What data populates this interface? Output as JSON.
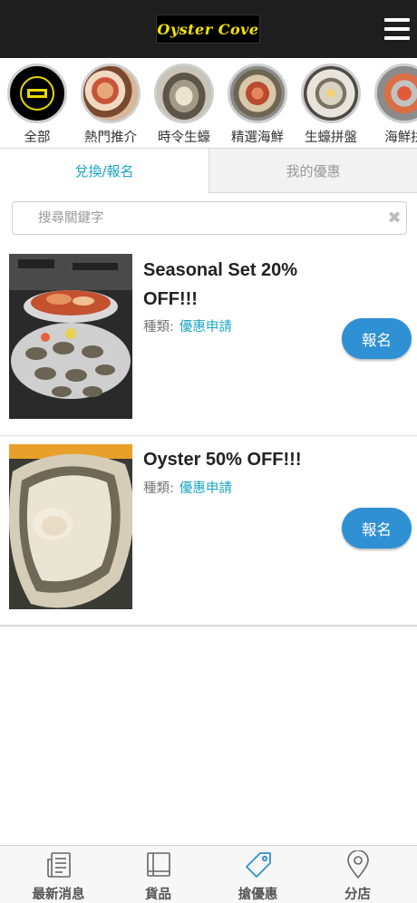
{
  "header": {
    "logo_text": "Oyster Cove",
    "menu_icon": "hamburger-menu-icon"
  },
  "categories": [
    {
      "label": "全部"
    },
    {
      "label": "熱門推介"
    },
    {
      "label": "時令生蠔"
    },
    {
      "label": "精選海鮮"
    },
    {
      "label": "生蠔拼盤"
    },
    {
      "label": "海鮮拼"
    }
  ],
  "tabs": {
    "redeem": "兌換/報名",
    "my_offers": "我的優惠"
  },
  "search": {
    "placeholder": "搜尋關鍵字",
    "value": ""
  },
  "offers": [
    {
      "title": "Seasonal Set 20% OFF!!!",
      "type_label": "種類:",
      "type_value": "優惠申請",
      "button": "報名"
    },
    {
      "title": "Oyster 50% OFF!!!",
      "type_label": "種類:",
      "type_value": "優惠申請",
      "button": "報名"
    }
  ],
  "tabbar": [
    {
      "label": "最新消息",
      "icon": "newspaper-icon"
    },
    {
      "label": "貨品",
      "icon": "book-icon"
    },
    {
      "label": "搶優惠",
      "icon": "tag-icon"
    },
    {
      "label": "分店",
      "icon": "map-pin-icon"
    }
  ],
  "colors": {
    "accent": "#1aa5c4",
    "button": "#2f90d4",
    "header_bg": "#1e1e1e",
    "logo_text": "#f5e400"
  }
}
